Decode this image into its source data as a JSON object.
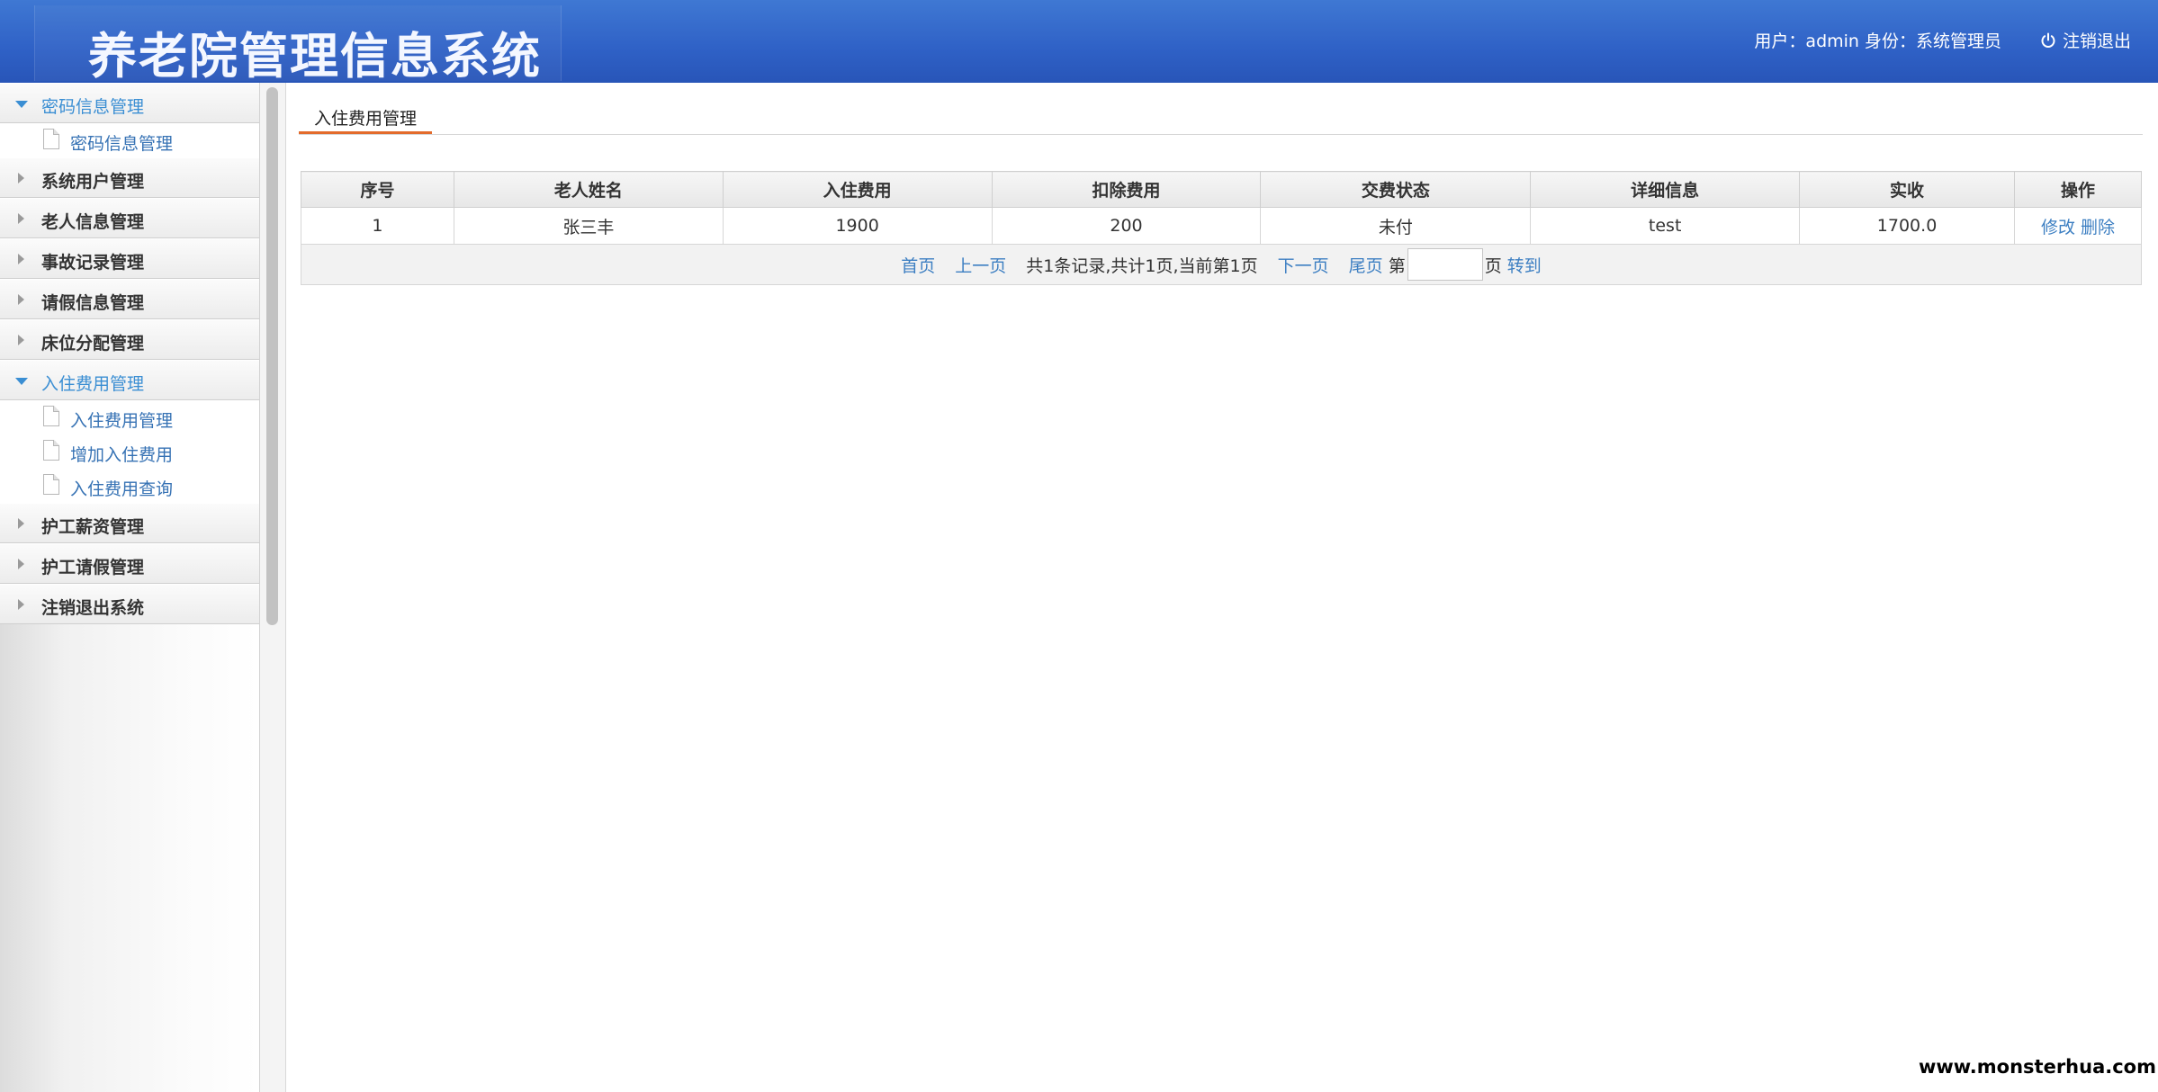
{
  "header": {
    "title": "养老院管理信息系统",
    "user_info": "用户：admin 身份：系统管理员",
    "logout_label": "注销退出"
  },
  "sidebar": {
    "groups": [
      {
        "label": "密码信息管理",
        "open": true,
        "items": [
          "密码信息管理"
        ]
      },
      {
        "label": "系统用户管理",
        "open": false
      },
      {
        "label": "老人信息管理",
        "open": false
      },
      {
        "label": "事故记录管理",
        "open": false
      },
      {
        "label": "请假信息管理",
        "open": false
      },
      {
        "label": "床位分配管理",
        "open": false
      },
      {
        "label": "入住费用管理",
        "open": true,
        "items": [
          "入住费用管理",
          "增加入住费用",
          "入住费用查询"
        ]
      },
      {
        "label": "护工薪资管理",
        "open": false
      },
      {
        "label": "护工请假管理",
        "open": false
      },
      {
        "label": "注销退出系统",
        "open": false
      }
    ]
  },
  "main": {
    "tab_label": "入住费用管理",
    "table": {
      "headers": [
        "序号",
        "老人姓名",
        "入住费用",
        "扣除费用",
        "交费状态",
        "详细信息",
        "实收",
        "操作"
      ],
      "rows": [
        {
          "no": "1",
          "name": "张三丰",
          "fee": "1900",
          "deduct": "200",
          "status": "未付",
          "detail": "test",
          "actual": "1700.0",
          "edit": "修改",
          "delete": "删除"
        }
      ]
    },
    "pager": {
      "first": "首页",
      "prev": "上一页",
      "summary": "共1条记录,共计1页,当前第1页",
      "next": "下一页",
      "last": "尾页",
      "page_prefix": "第",
      "page_suffix": "页",
      "go": "转到",
      "page_input_value": ""
    }
  },
  "watermark": "www.monsterhua.com",
  "colors": {
    "header_blue": "#2f61c6",
    "link_blue": "#3d7fc2",
    "tab_underline": "#e36b2c"
  }
}
